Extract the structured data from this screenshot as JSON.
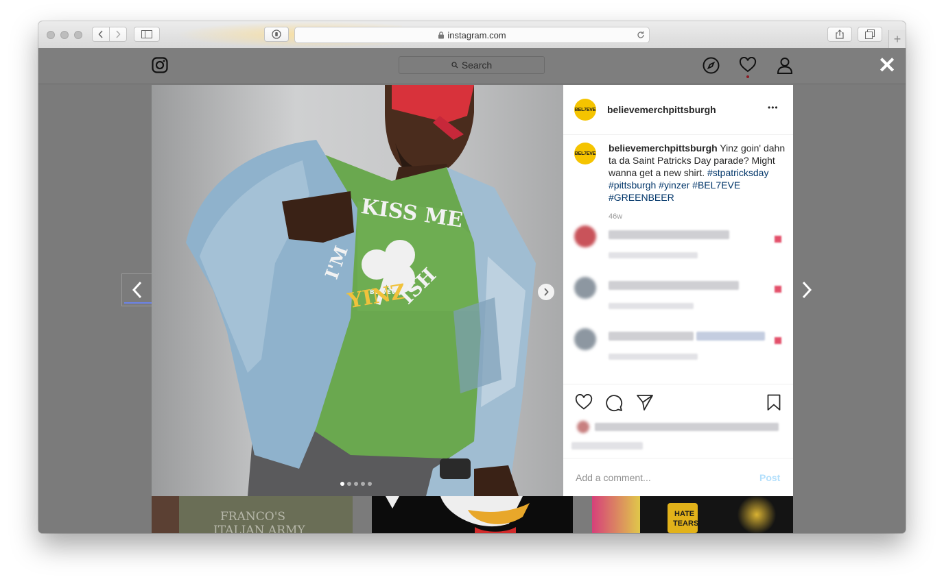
{
  "browser": {
    "url": "instagram.com",
    "add_tab_glyph": "+"
  },
  "ig": {
    "search_placeholder": "Search",
    "icons": [
      "instagram-logo-icon",
      "compass-icon",
      "heart-icon",
      "profile-icon"
    ],
    "close_glyph": "✕"
  },
  "photo": {
    "shirt_text_top": "KISS ME",
    "shirt_text_left": "I'M",
    "shirt_brand": "BEL7EVE",
    "shirt_text_bottom": "YINZ",
    "shirt_text_bottom_suffix": "ISH",
    "carousel_dots": 5,
    "active_dot": 0
  },
  "post": {
    "username": "believemerchpittsburgh",
    "avatar_text": "BEL7EVE",
    "more_glyph": "•••",
    "caption_user": "believemerchpittsburgh",
    "caption_text": "Yinz goin' dahn ta da Saint Patricks Day parade? Might wanna get a new shirt.",
    "hashtags": "#stpatricksday #pittsburgh #yinzer #BEL7EVE #GREENBEER",
    "timestamp": "46w",
    "comment_placeholder": "Add a comment...",
    "post_button": "Post"
  },
  "thumbnails": {
    "first_text_line1": "FRANCO'S",
    "first_text_line2": "ITALIAN ARMY",
    "third_text_line1": "HATE",
    "third_text_line2": "TEARS"
  },
  "colors": {
    "shirt_green": "#6aa84f",
    "logo_yellow": "#f5c400",
    "link_blue": "#003569",
    "post_blue": "#b2dffc"
  }
}
